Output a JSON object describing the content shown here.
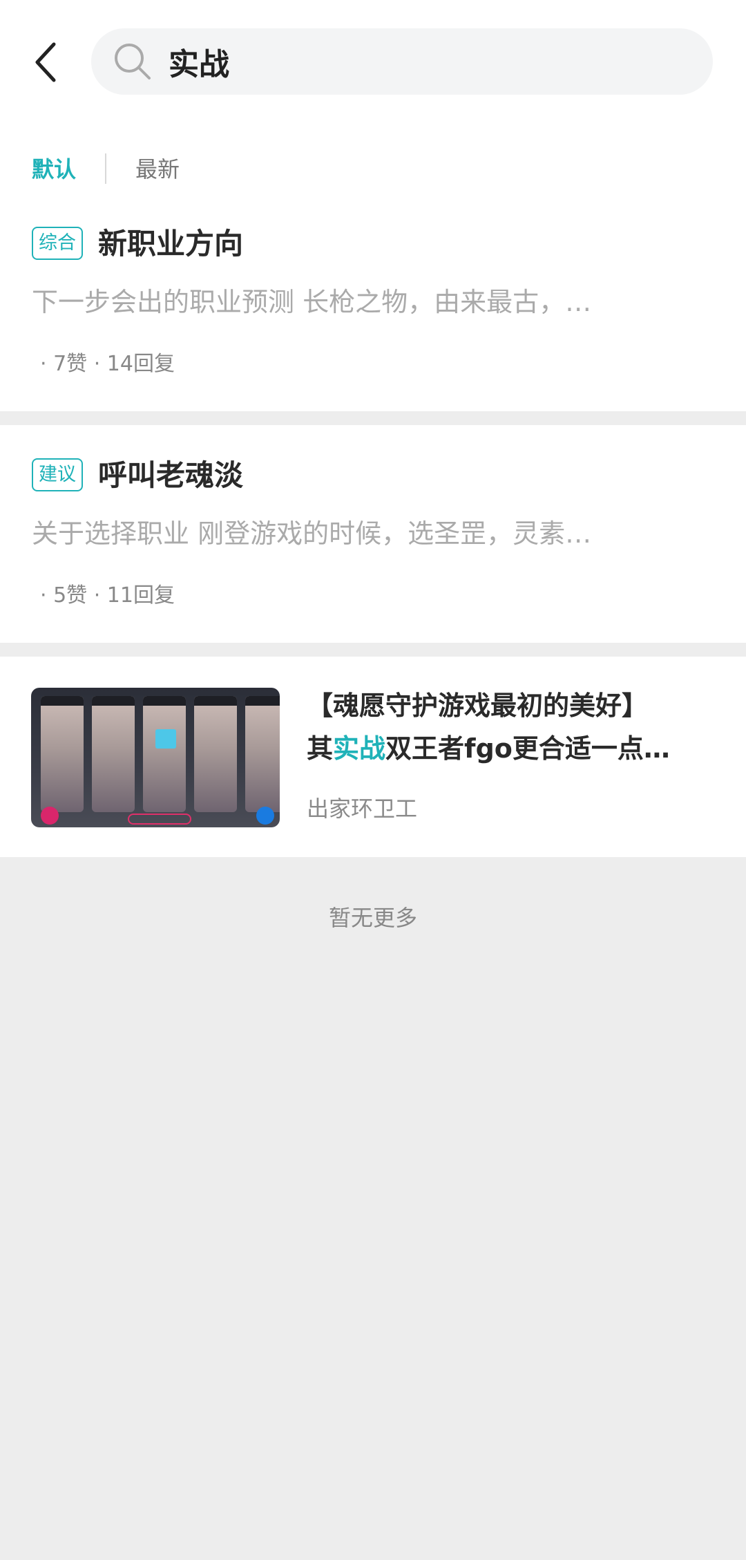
{
  "search": {
    "query": "实战"
  },
  "sort": {
    "default_label": "默认",
    "latest_label": "最新"
  },
  "posts": [
    {
      "tag": "综合",
      "title": "新职业方向",
      "excerpt": "下一步会出的职业预测 长枪之物，由来最古，…",
      "meta": "· 7赞 · 14回复"
    },
    {
      "tag": "建议",
      "title": "呼叫老魂淡",
      "excerpt": "关于选择职业 刚登游戏的时候，选圣罡，灵素…",
      "meta": "· 5赞 · 11回复"
    },
    {
      "title_line1": "【魂愿守护游戏最初的美好】",
      "title_line2_prefix": "其",
      "title_line2_highlight": "实战",
      "title_line2_suffix": "双王者fgo更合适一点…",
      "author": "出家环卫工"
    }
  ],
  "footer": {
    "no_more": "暂无更多"
  },
  "colors": {
    "accent": "#1fb2b8"
  }
}
